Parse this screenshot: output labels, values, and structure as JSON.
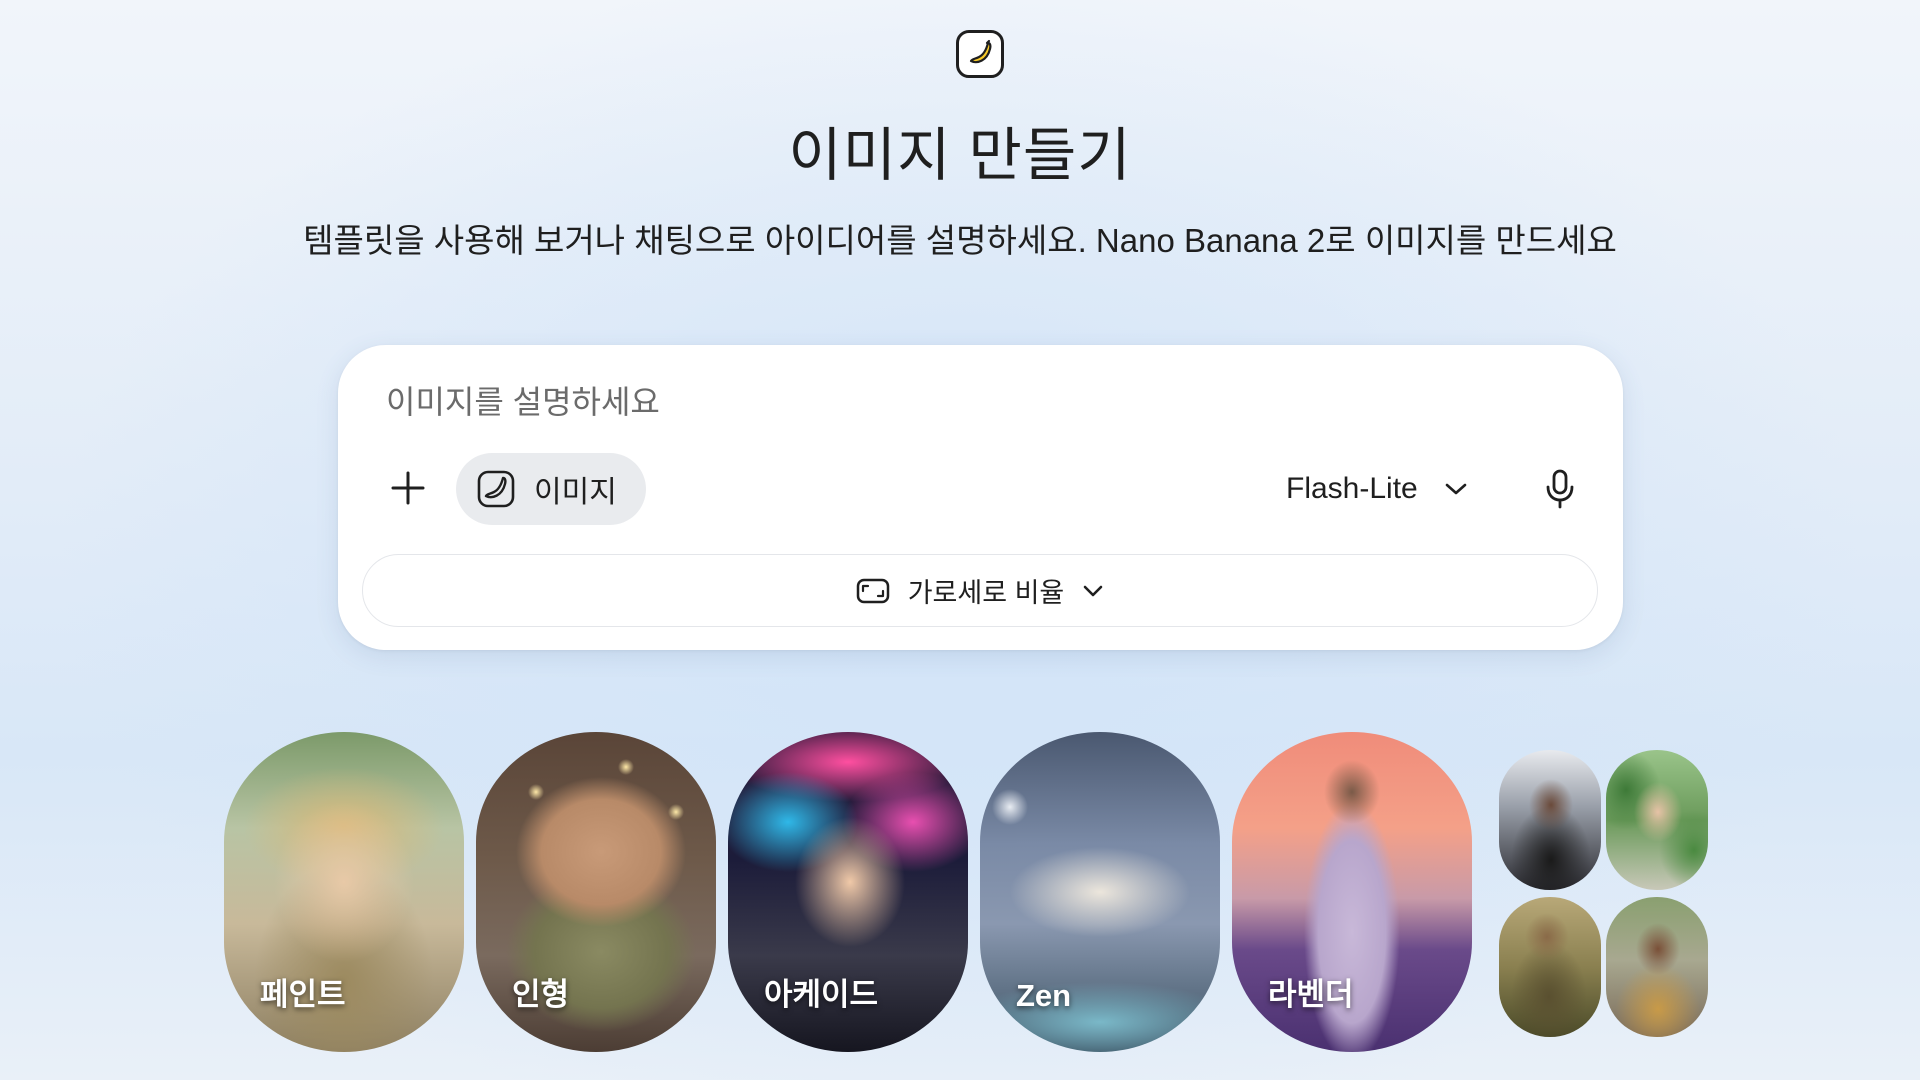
{
  "header": {
    "logo_icon": "banana-icon",
    "title": "이미지 만들기",
    "subtitle": "템플릿을 사용해 보거나 채팅으로 아이디어를 설명하세요. Nano Banana 2로 이미지를 만드세요"
  },
  "composer": {
    "placeholder": "이미지를 설명하세요",
    "value": "",
    "add_icon": "plus-icon",
    "tool_chip": {
      "label": "이미지",
      "icon": "banana-icon"
    },
    "model": {
      "label": "Flash-Lite",
      "icon": "chevron-down-icon"
    },
    "mic_icon": "microphone-icon",
    "aspect_ratio": {
      "label": "가로세로 비율",
      "icon": "aspect-ratio-icon"
    }
  },
  "templates": [
    {
      "label": "페인트"
    },
    {
      "label": "인형"
    },
    {
      "label": "아케이드"
    },
    {
      "label": "Zen"
    },
    {
      "label": "라벤더"
    }
  ],
  "colors": {
    "text": "#1f1f1f",
    "placeholder": "#6b6b6b",
    "chip_bg": "#e9ebee",
    "banana": "#f7c928"
  }
}
